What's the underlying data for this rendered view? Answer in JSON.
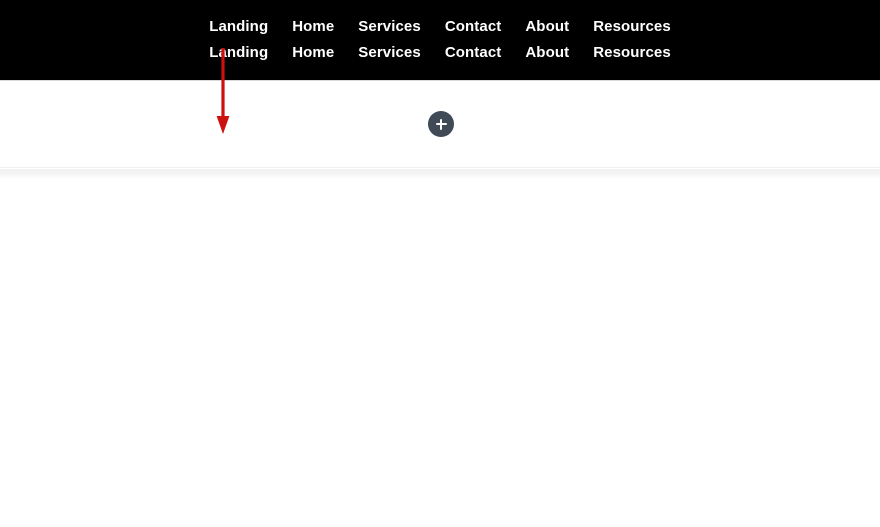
{
  "navbar": {
    "background_color": "#000000",
    "text_color": "#ffffff",
    "rows": [
      {
        "items": [
          {
            "label": "Landing"
          },
          {
            "label": "Home"
          },
          {
            "label": "Services"
          },
          {
            "label": "Contact"
          },
          {
            "label": "About"
          },
          {
            "label": "Resources"
          }
        ]
      },
      {
        "items": [
          {
            "label": "Landing"
          },
          {
            "label": "Home"
          },
          {
            "label": "Services"
          },
          {
            "label": "Contact"
          },
          {
            "label": "About"
          },
          {
            "label": "Resources"
          }
        ]
      }
    ]
  },
  "hero": {
    "add_button": {
      "icon": "plus-icon",
      "label": "+",
      "color": "#3f4a56",
      "icon_color": "#ffffff"
    }
  },
  "annotation": {
    "arrow": {
      "icon": "arrow-down-icon",
      "color": "#cc1111",
      "direction": "down"
    }
  }
}
